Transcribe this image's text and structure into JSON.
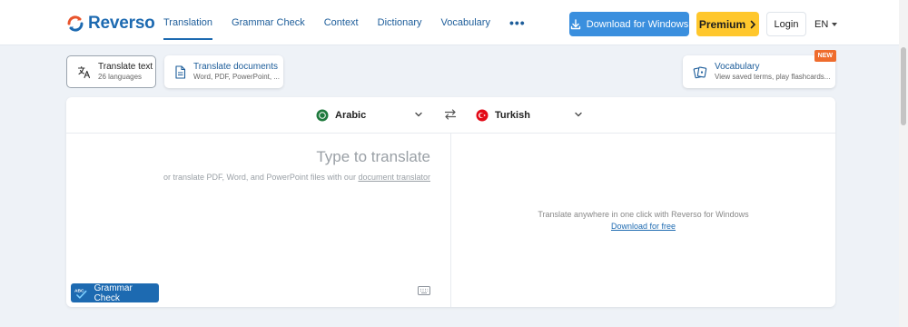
{
  "header": {
    "logo_text": "Reverso",
    "nav": [
      {
        "label": "Translation",
        "active": true
      },
      {
        "label": "Grammar Check",
        "active": false
      },
      {
        "label": "Context",
        "active": false
      },
      {
        "label": "Dictionary",
        "active": false
      },
      {
        "label": "Vocabulary",
        "active": false
      }
    ],
    "more_label": "•••",
    "download_label": "Download for Windows",
    "premium_label": "Premium",
    "login_label": "Login",
    "language": "EN"
  },
  "modes": {
    "text": {
      "title": "Translate text",
      "subtitle": "26 languages"
    },
    "documents": {
      "title": "Translate documents",
      "subtitle": "Word, PDF, PowerPoint, ..."
    },
    "vocabulary": {
      "title": "Vocabulary",
      "subtitle": "View saved terms, play flashcards...",
      "badge": "NEW"
    }
  },
  "translator": {
    "source_language": "Arabic",
    "target_language": "Turkish",
    "source_placeholder": "Type to translate",
    "source_hint_prefix": "or translate PDF, Word, and PowerPoint files with our ",
    "source_hint_link": "document translator",
    "target_info": "Translate anywhere in one click with Reverso for Windows",
    "target_link": "Download for free",
    "grammar_button": "Grammar Check"
  },
  "colors": {
    "brand_blue": "#1d6ab1",
    "download_blue": "#3a8fde",
    "premium_yellow": "#ffc72c",
    "new_badge_orange": "#ef6c2d",
    "page_background": "#eef2f7"
  },
  "icons": {
    "download": "download-icon",
    "chevron": "chevron-right-icon",
    "translate_text": "translate-icon",
    "document": "document-icon",
    "vocabulary": "flashcards-icon",
    "arabic_flag": "saudi-flag-icon",
    "turkish_flag": "turkey-flag-icon",
    "swap": "swap-arrows-icon",
    "keyboard": "keyboard-icon",
    "grammar": "abc-check-icon"
  }
}
